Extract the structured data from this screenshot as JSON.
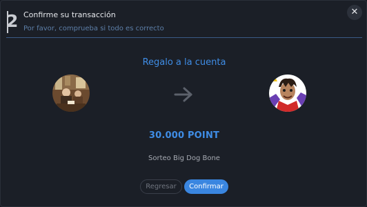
{
  "header": {
    "step_number": "2",
    "title": "Confirme su transacción",
    "subtitle": "Por favor, comprueba si todo es correcto",
    "close_glyph": "✕"
  },
  "main": {
    "section_title": "Regalo a la cuenta",
    "amount": "30.000 POINT",
    "description": "Sorteo Big Dog Bone",
    "arrow_icon": "arrow-right-icon"
  },
  "actions": {
    "back_label": "Regresar",
    "confirm_label": "Confirmar"
  },
  "colors": {
    "accent": "#3f8de6",
    "background": "#1b1f27",
    "button_primary": "#3a86e0"
  }
}
